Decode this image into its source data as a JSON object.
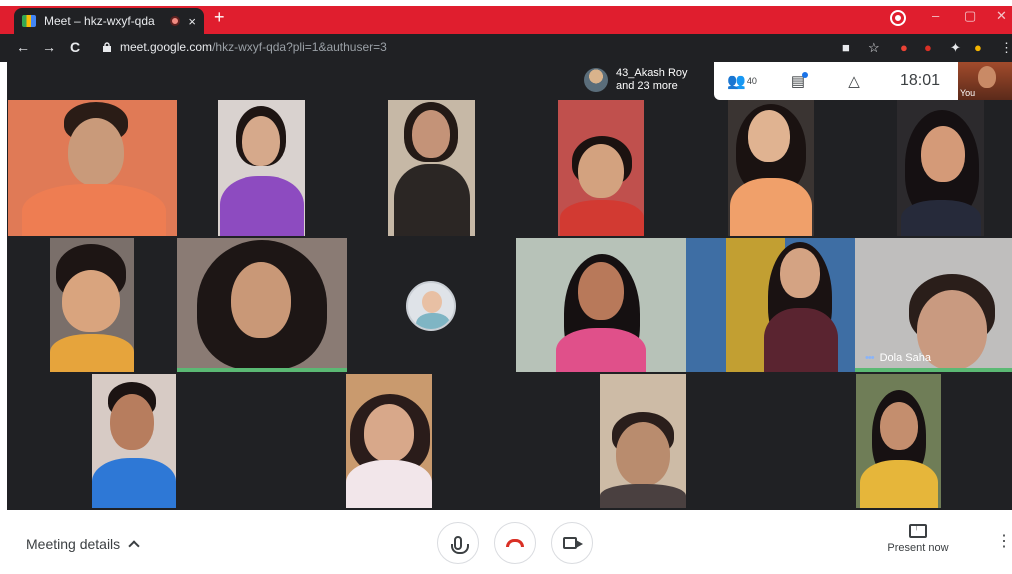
{
  "browser": {
    "tab_title": "Meet – hkz-wxyf-qda",
    "new_tab": "+",
    "close_tab": "×",
    "url_host": "meet.google.com",
    "url_path": "/hkz-wxyf-qda?pli=1&authuser=3",
    "nav_back": "←",
    "nav_forward": "→",
    "nav_reload": "C",
    "win_min": "–",
    "win_max": "▢",
    "win_close": "✕"
  },
  "header": {
    "participant_line1": "43_Akash Roy",
    "participant_line2": "and 23 more",
    "people_count": "40",
    "time": "18:01",
    "self_label": "You"
  },
  "tiles": {
    "dola_name": "Dola Saha"
  },
  "bottom": {
    "meeting_details": "Meeting details",
    "present_now": "Present now",
    "more": "⋮"
  },
  "colors": {
    "chrome_red": "#e01e2e",
    "meet_dark": "#202124",
    "hangup_red": "#d93025",
    "accent_blue": "#1a73e8"
  }
}
